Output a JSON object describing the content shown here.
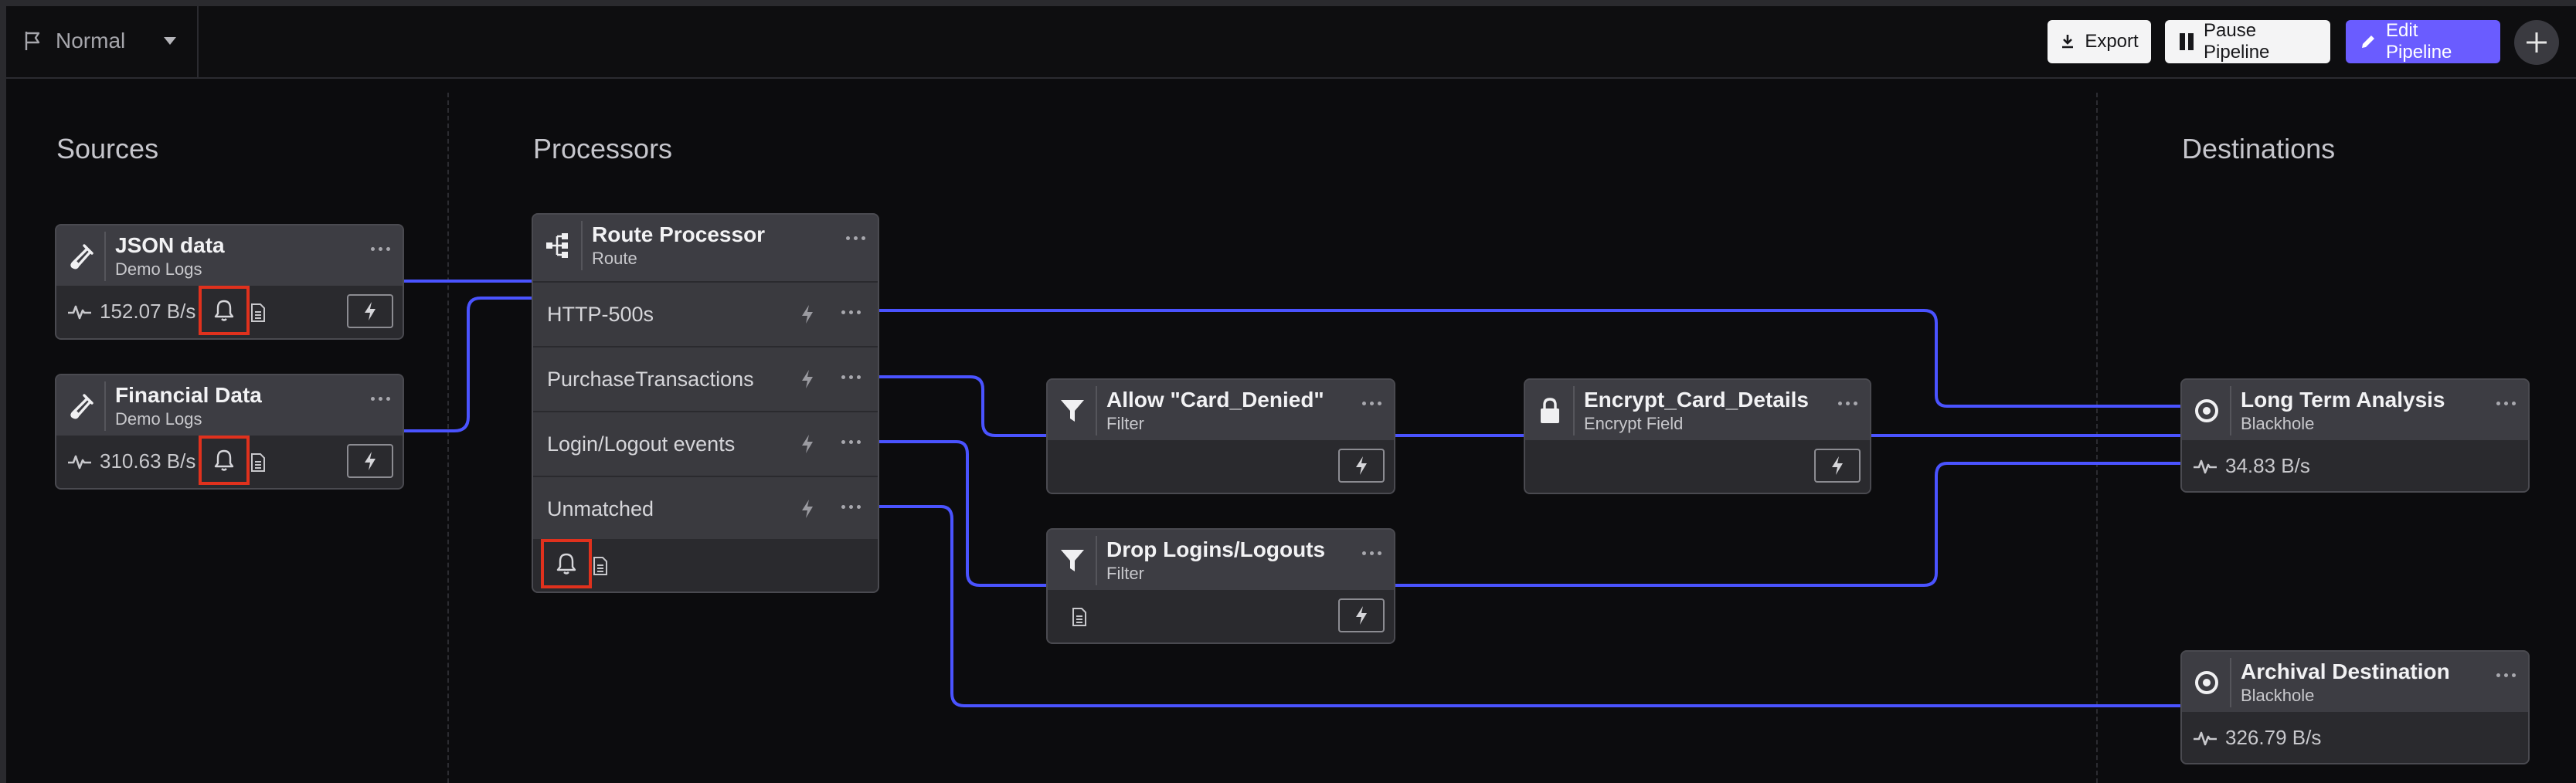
{
  "toolbar": {
    "mode_label": "Normal",
    "export_label": "Export",
    "pause_label": "Pause Pipeline",
    "edit_label": "Edit Pipeline"
  },
  "columns": {
    "sources": "Sources",
    "processors": "Processors",
    "destinations": "Destinations"
  },
  "sources": [
    {
      "name": "JSON data",
      "subtitle": "Demo Logs",
      "rate": "152.07 B/s"
    },
    {
      "name": "Financial Data",
      "subtitle": "Demo Logs",
      "rate": "310.63 B/s"
    }
  ],
  "router": {
    "name": "Route Processor",
    "subtitle": "Route",
    "routes": [
      "HTTP-500s",
      "PurchaseTransactions",
      "Login/Logout events",
      "Unmatched"
    ]
  },
  "processors": [
    {
      "name": "Allow \"Card_Denied\"",
      "subtitle": "Filter"
    },
    {
      "name": "Drop Logins/Logouts",
      "subtitle": "Filter"
    },
    {
      "name": "Encrypt_Card_Details",
      "subtitle": "Encrypt Field"
    }
  ],
  "destinations": [
    {
      "name": "Long Term Analysis",
      "subtitle": "Blackhole",
      "rate": "34.83 B/s"
    },
    {
      "name": "Archival Destination",
      "subtitle": "Blackhole",
      "rate": "326.79 B/s"
    }
  ],
  "colors": {
    "edge": "#4a53ff",
    "accent": "#6a5cff",
    "highlight": "#e0311d"
  }
}
